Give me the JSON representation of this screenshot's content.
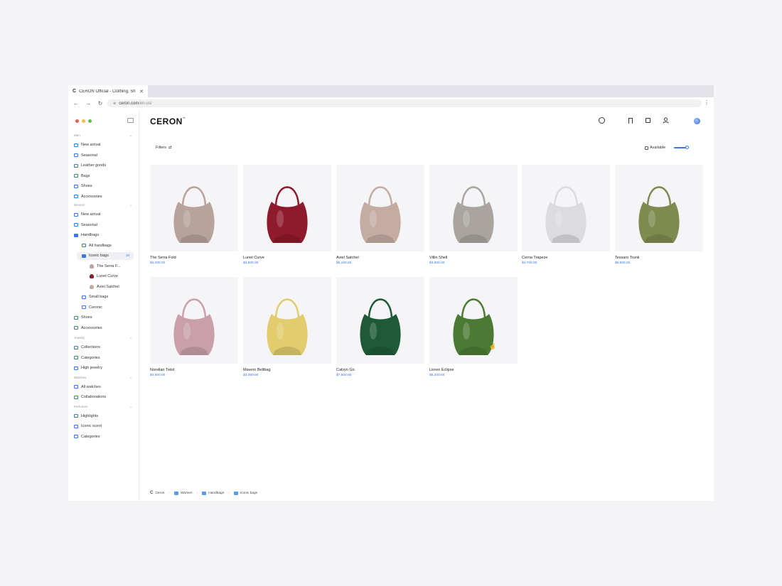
{
  "browser": {
    "tab_title": "CERON Official - Clothing, Sh",
    "tab_favicon": "C",
    "url_host": "ceron.com",
    "url_path": "/en-us/"
  },
  "sidebar": {
    "groups": [
      {
        "label": "Men",
        "items": [
          "New arrival",
          "Seasonal",
          "Leather goods",
          "Bags",
          "Shoes",
          "Accessories"
        ]
      },
      {
        "label": "Women",
        "items": [
          "New arrival",
          "Seasonal",
          "Handbags"
        ]
      },
      {
        "label": "Jewelry",
        "items": [
          "Collections",
          "Categories",
          "High jewelry"
        ]
      },
      {
        "label": "Watches",
        "items": [
          "All watches",
          "Collaborations"
        ]
      },
      {
        "label": "Perfumes",
        "items": [
          "Highlights",
          "Iconic scent",
          "Categories"
        ]
      }
    ],
    "handbags_children": [
      "All handbags",
      "Iconic bags",
      "Small bags",
      "Ceronic"
    ],
    "iconic_count": "10",
    "iconic_children": [
      "The Serra F...",
      "Lunet Curve",
      "Aviel Satchel"
    ],
    "women_after": [
      "Shoes",
      "Accessories"
    ]
  },
  "header": {
    "logo": "CERON",
    "logo_mark": "™"
  },
  "toolbar": {
    "filters_label": "Filters",
    "filters_icon": "⇄",
    "available_label": "Available",
    "available_checked": false
  },
  "products": [
    {
      "name": "The Serra Fold",
      "price": "$4,200.00",
      "color": "#b8a39c"
    },
    {
      "name": "Lunet Curve",
      "price": "$3,800.00",
      "color": "#8e1a2b"
    },
    {
      "name": "Aviel Satchel",
      "price": "$5,100.00",
      "color": "#c4aca3"
    },
    {
      "name": "Villin Shell",
      "price": "$3,900.00",
      "color": "#a9a59e"
    },
    {
      "name": "Cerna Trapeze",
      "price": "$4,700.00",
      "color": "#dcdcde"
    },
    {
      "name": "Tessaro Trunk",
      "price": "$6,900.00",
      "color": "#7e8a4e"
    },
    {
      "name": "Norellan Twist",
      "price": "$4,600.00",
      "color": "#c9a0aa"
    },
    {
      "name": "Mavero Beltbag",
      "price": "$3,350.00",
      "color": "#e2cc6d"
    },
    {
      "name": "Calvyn Go",
      "price": "$7,500.00",
      "color": "#1f5a38"
    },
    {
      "name": "Lioren Eclipse",
      "price": "$8,200.00",
      "color": "#4c7a35"
    }
  ],
  "breadcrumb": [
    "Ceron",
    "Women",
    "Handbags",
    "Iconic bags"
  ],
  "colors": {
    "accent": "#3b78e7"
  }
}
